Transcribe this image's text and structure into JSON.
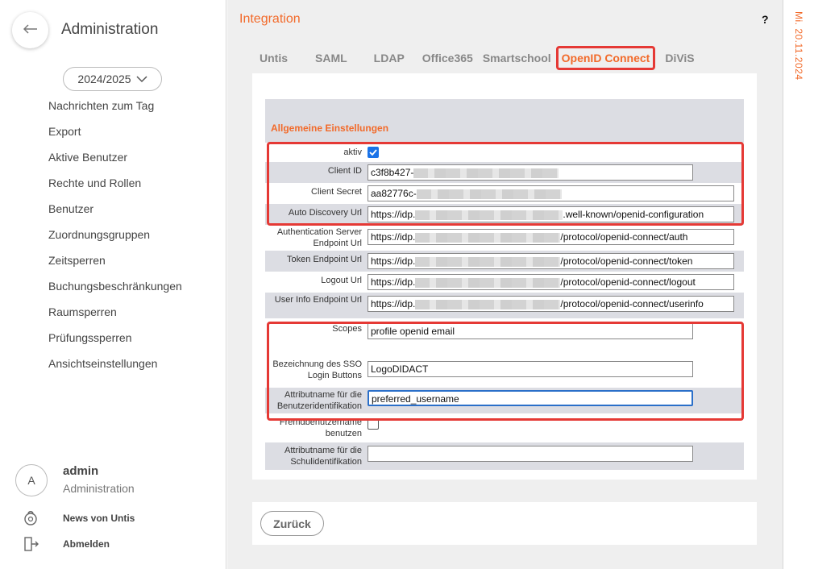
{
  "sidebar": {
    "back_icon": "arrow-left-icon",
    "title": "Administration",
    "school_year": "2024/2025",
    "nav_items": [
      {
        "label": "Nachrichten zum Tag"
      },
      {
        "label": "Export"
      },
      {
        "label": "Aktive Benutzer"
      },
      {
        "label": "Rechte und Rollen"
      },
      {
        "label": "Benutzer"
      },
      {
        "label": "Zuordnungsgruppen"
      },
      {
        "label": "Zeitsperren"
      },
      {
        "label": "Buchungsbeschränkungen"
      },
      {
        "label": "Raumsperren"
      },
      {
        "label": "Prüfungssperren"
      },
      {
        "label": "Ansichtseinstellungen"
      }
    ],
    "user": {
      "initial": "A",
      "name": "admin",
      "role": "Administration"
    },
    "news_link": "News von Untis",
    "logout_link": "Abmelden"
  },
  "main": {
    "title": "Integration",
    "help": "?",
    "tabs": [
      {
        "label": "Untis",
        "active": false
      },
      {
        "label": "SAML",
        "active": false
      },
      {
        "label": "LDAP",
        "active": false
      },
      {
        "label": "Office365",
        "active": false
      },
      {
        "label": "Smartschool",
        "active": false
      },
      {
        "label": "OpenID Connect",
        "active": true
      },
      {
        "label": "DiViS",
        "active": false
      }
    ],
    "section_title": "Allgemeine Einstellungen",
    "fields": {
      "aktiv": {
        "label": "aktiv",
        "checked": true
      },
      "client_id": {
        "label": "Client ID",
        "value_prefix": "c3f8b427-"
      },
      "client_secret": {
        "label": "Client Secret",
        "value_prefix": "aa82776c-"
      },
      "auto_discovery": {
        "label": "Auto Discovery Url",
        "value_prefix": "https://idp.",
        "value_suffix": ".well-known/openid-configuration"
      },
      "auth_endpoint": {
        "label": "Authentication Server Endpoint Url",
        "value_prefix": "https://idp.",
        "value_suffix": "/protocol/openid-connect/auth"
      },
      "token_endpoint": {
        "label": "Token Endpoint Url",
        "value_prefix": "https://idp.",
        "value_suffix": "/protocol/openid-connect/token"
      },
      "logout": {
        "label": "Logout Url",
        "value_prefix": "https://idp.",
        "value_suffix": "/protocol/openid-connect/logout"
      },
      "userinfo": {
        "label": "User Info Endpoint Url",
        "value_prefix": "https://idp.",
        "value_suffix": "/protocol/openid-connect/userinfo"
      },
      "scopes": {
        "label": "Scopes",
        "value": "profile openid email"
      },
      "sso_button": {
        "label": "Bezeichnung des SSO Login Buttons",
        "value": "LogoDIDACT"
      },
      "user_attr": {
        "label": "Attributname für die Benutzeridentifikation",
        "value": "preferred_username"
      },
      "foreign_user": {
        "label": "Fremdbenutzername benutzen",
        "checked": false
      },
      "school_attr": {
        "label": "Attributname für die Schulidentifikation",
        "value": ""
      }
    },
    "back_button": "Zurück"
  },
  "date": "Mi. 20.11.2024",
  "colors": {
    "accent": "#f26a2a",
    "highlight": "#e53935",
    "checkbox": "#1a73e8"
  }
}
